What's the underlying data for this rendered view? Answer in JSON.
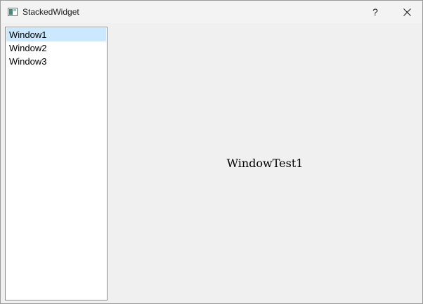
{
  "window": {
    "title": "StackedWidget",
    "help_label": "?",
    "icons": {
      "app": "app-window-icon",
      "help": "help-icon",
      "close": "close-icon"
    }
  },
  "list": {
    "items": [
      {
        "label": "Window1",
        "selected": true
      },
      {
        "label": "Window2",
        "selected": false
      },
      {
        "label": "Window3",
        "selected": false
      }
    ],
    "selection_color": "#cce8ff"
  },
  "stack": {
    "current_page_text": "WindowTest1"
  }
}
